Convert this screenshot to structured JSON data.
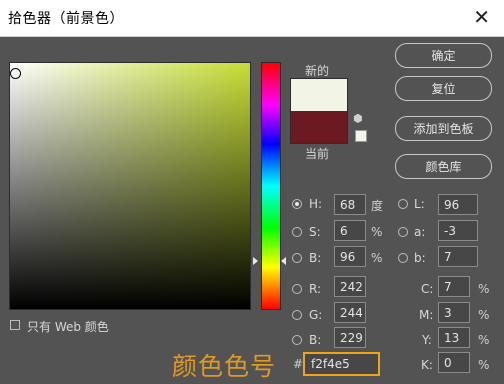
{
  "window": {
    "title": "拾色器（前景色）",
    "close_icon": "close-icon"
  },
  "swatch": {
    "new_label": "新的",
    "current_label": "当前",
    "new_color": "#f2f4e5",
    "current_color": "#6b1a22"
  },
  "buttons": {
    "ok": "确定",
    "reset": "复位",
    "add_swatch": "添加到色板",
    "libraries": "颜色库"
  },
  "hsb": {
    "h": {
      "label": "H:",
      "value": "68",
      "unit": "度"
    },
    "s": {
      "label": "S:",
      "value": "6",
      "unit": "%"
    },
    "b": {
      "label": "B:",
      "value": "96",
      "unit": "%"
    }
  },
  "lab": {
    "l": {
      "label": "L:",
      "value": "96"
    },
    "a": {
      "label": "a:",
      "value": "-3"
    },
    "b": {
      "label": "b:",
      "value": "7"
    }
  },
  "rgb": {
    "r": {
      "label": "R:",
      "value": "242"
    },
    "g": {
      "label": "G:",
      "value": "244"
    },
    "b": {
      "label": "B:",
      "value": "229"
    }
  },
  "cmyk": {
    "c": {
      "label": "C:",
      "value": "7",
      "unit": "%"
    },
    "m": {
      "label": "M:",
      "value": "3",
      "unit": "%"
    },
    "y": {
      "label": "Y:",
      "value": "13",
      "unit": "%"
    },
    "k": {
      "label": "K:",
      "value": "0",
      "unit": "%"
    }
  },
  "hex": {
    "hash": "#",
    "value": "f2f4e5"
  },
  "web_only": {
    "label": "只有 Web 颜色",
    "checked": false
  },
  "annotation": "颜色色号",
  "colors": {
    "accent": "#f0a318",
    "dialog_bg": "#535353",
    "field_hue": "#c6dd34"
  }
}
